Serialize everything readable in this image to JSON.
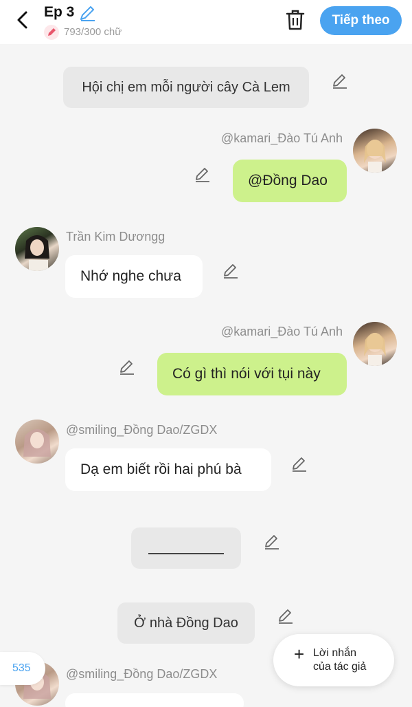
{
  "header": {
    "episode_title": "Ep 3",
    "word_count": "793/300 chữ",
    "next_label": "Tiếp theo"
  },
  "messages": [
    {
      "kind": "narration",
      "text": "Hội chị em mỗi người cây Cà Lem"
    },
    {
      "kind": "me",
      "name": "@kamari_Đào Tú Anh",
      "text": "@Đồng Dao"
    },
    {
      "kind": "other",
      "name": "Trần Kim Dươngg",
      "text": "Nhớ nghe chưa"
    },
    {
      "kind": "me",
      "name": "@kamari_Đào Tú Anh",
      "text": "Có gì thì nói với tụi này"
    },
    {
      "kind": "other",
      "name": "@smiling_Đồng Dao/ZGDX",
      "text": "Dạ em biết rồi hai phú bà"
    },
    {
      "kind": "narration",
      "text": ""
    },
    {
      "kind": "narration",
      "text": "Ở nhà Đồng Dao"
    },
    {
      "kind": "other",
      "name": "@smiling_Đồng Dao/ZGDX",
      "text": ""
    }
  ],
  "footer": {
    "counter": "535",
    "author_note_line1": "Lời nhắn",
    "author_note_line2": "của tác giả"
  },
  "colors": {
    "accent": "#4aa3f0",
    "my_bubble": "#cdf18c",
    "other_bubble": "#ffffff",
    "narration_bg": "#e8e8e8",
    "background": "#f5f5f5"
  },
  "icons": {
    "back": "chevron-left-icon",
    "title_edit": "pencil-icon",
    "trash": "trash-icon",
    "edit": "pencil-icon",
    "add": "plus-icon"
  }
}
